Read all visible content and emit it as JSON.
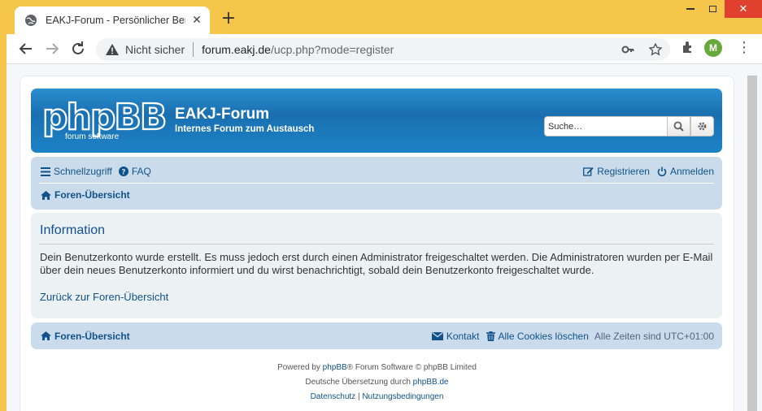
{
  "browser": {
    "tab_title": "EAKJ-Forum - Persönlicher Bereich",
    "tab_close": "✕",
    "new_tab": "+",
    "not_secure": "Nicht sicher",
    "url_host": "forum.eakj.de",
    "url_path": "/ucp.php?mode=register",
    "profile_initial": "M"
  },
  "header": {
    "logo_text": "phpBB",
    "logo_sub": "forum software",
    "site_title": "EAKJ-Forum",
    "site_description": "Internes Forum zum Austausch",
    "search_placeholder": "Suche…"
  },
  "navbar": {
    "quicklinks": "Schnellzugriff",
    "faq": "FAQ",
    "register": "Registrieren",
    "login": "Anmelden",
    "breadcrumb_home": "Foren-Übersicht"
  },
  "panel": {
    "title": "Information",
    "message": "Dein Benutzerkonto wurde erstellt. Es muss jedoch erst durch einen Administrator freigeschaltet werden. Die Administratoren wurden per E-Mail über dein neues Benutzerkonto informiert und du wirst benachrichtigt, sobald dein Benutzerkonto freigeschaltet wurde.",
    "back_link": "Zurück zur Foren-Übersicht"
  },
  "footer_nav": {
    "home": "Foren-Übersicht",
    "contact": "Kontakt",
    "delete_cookies": "Alle Cookies löschen",
    "timezone": "Alle Zeiten sind UTC+01:00"
  },
  "copyright": {
    "powered_prefix": "Powered by ",
    "powered_link": "phpBB",
    "powered_suffix": "® Forum Software © phpBB Limited",
    "translation_prefix": "Deutsche Übersetzung durch ",
    "translation_link": "phpBB.de",
    "privacy": "Datenschutz",
    "separator": " | ",
    "terms": "Nutzungsbedingungen"
  },
  "colors": {
    "header_blue": "#1c76bc",
    "nav_bg": "#cadceb",
    "panel_bg": "#ecf1f3",
    "link": "#105289",
    "window_frame": "#f5c64a"
  }
}
